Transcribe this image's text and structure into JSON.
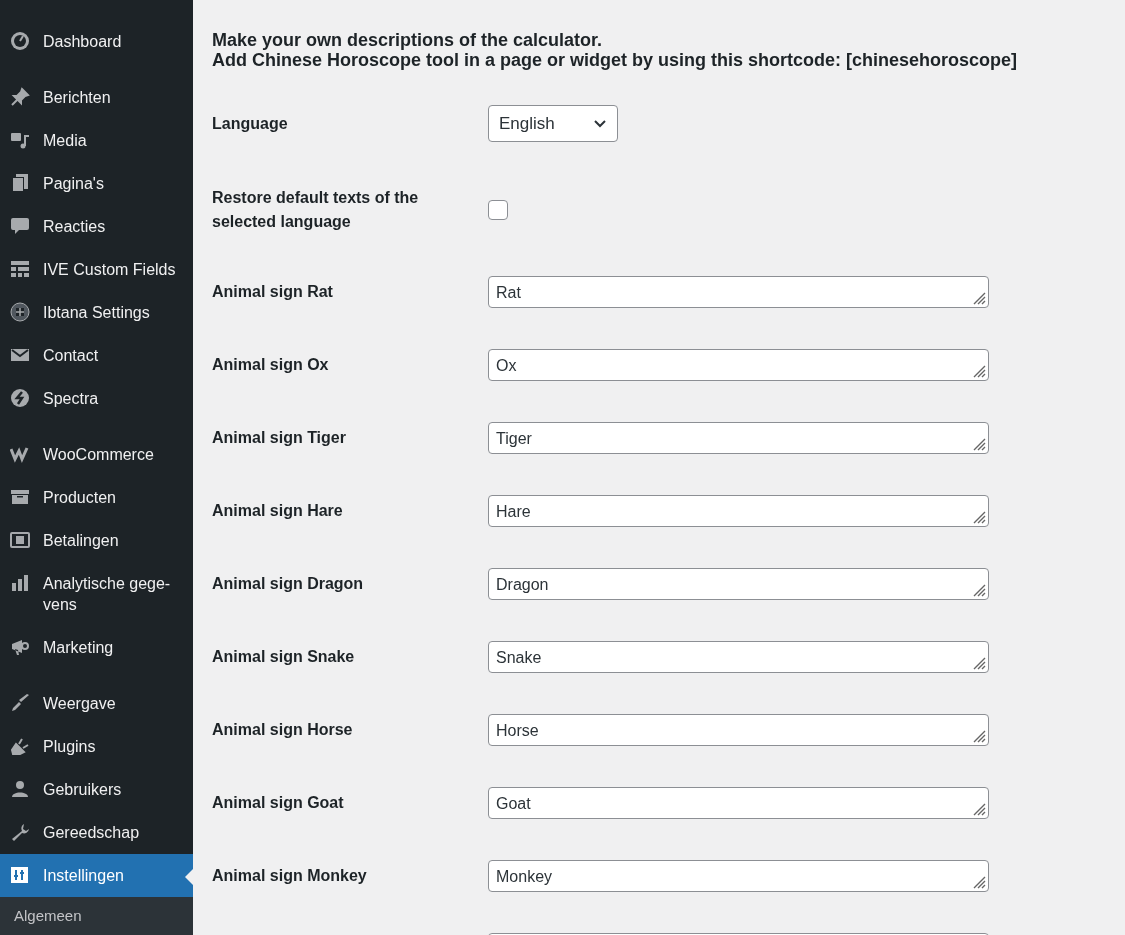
{
  "sidebar": {
    "groups": [
      [
        {
          "label": "Dashboard",
          "selected": false
        }
      ],
      [
        {
          "label": "Berichten",
          "selected": false
        },
        {
          "label": "Media",
          "selected": false
        },
        {
          "label": "Pagina's",
          "selected": false
        },
        {
          "label": "Reacties",
          "selected": false
        },
        {
          "label": "IVE Custom Fields",
          "selected": false
        },
        {
          "label": "Ibtana Settings",
          "selected": false
        },
        {
          "label": "Contact",
          "selected": false
        },
        {
          "label": "Spectra",
          "selected": false
        }
      ],
      [
        {
          "label": "WooCommerce",
          "selected": false
        },
        {
          "label": "Producten",
          "selected": false
        },
        {
          "label": "Betalingen",
          "selected": false
        },
        {
          "label": "Analytische gege-vens",
          "selected": false
        },
        {
          "label": "Marketing",
          "selected": false
        }
      ],
      [
        {
          "label": "Weergave",
          "selected": false
        },
        {
          "label": "Plugins",
          "selected": false
        },
        {
          "label": "Gebruikers",
          "selected": false
        },
        {
          "label": "Gereedschap",
          "selected": false
        },
        {
          "label": "Instellingen",
          "selected": true
        }
      ]
    ],
    "submenu": [
      {
        "label": "Algemeen"
      }
    ]
  },
  "intro": [
    "Make your own descriptions of the calculator.",
    "Add Chinese Horoscope tool in a page or widget by using this shortcode: [chinesehoroscope]"
  ],
  "form": {
    "language": {
      "label": "Language",
      "value": "English"
    },
    "restore": {
      "label": "Restore default texts of the selected language",
      "checked": false
    },
    "fields": [
      {
        "label": "Animal sign Rat",
        "value": "Rat"
      },
      {
        "label": "Animal sign Ox",
        "value": "Ox"
      },
      {
        "label": "Animal sign Tiger",
        "value": "Tiger"
      },
      {
        "label": "Animal sign Hare",
        "value": "Hare"
      },
      {
        "label": "Animal sign Dragon",
        "value": "Dragon"
      },
      {
        "label": "Animal sign Snake",
        "value": "Snake"
      },
      {
        "label": "Animal sign Horse",
        "value": "Horse"
      },
      {
        "label": "Animal sign Goat",
        "value": "Goat"
      },
      {
        "label": "Animal sign Monkey",
        "value": "Monkey"
      }
    ],
    "next_field_cut_off": true
  }
}
